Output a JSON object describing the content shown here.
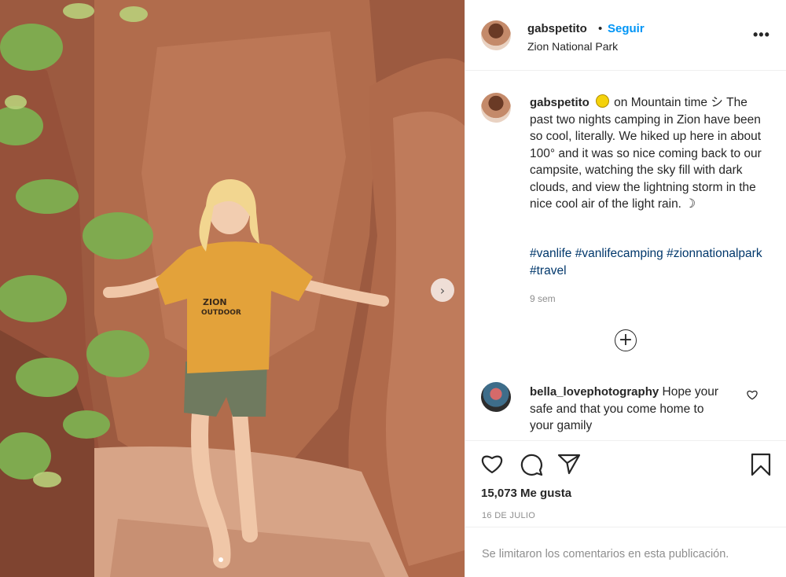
{
  "post": {
    "username": "gabspetito",
    "separator": "•",
    "follow_label": "Seguir",
    "location": "Zion National Park",
    "more_icon": "more-horizontal-icon"
  },
  "caption": {
    "username": "gabspetito",
    "emoji": "lemon-emoji",
    "text": "on Mountain time シ The past two nights camping in Zion have been so cool, literally. We hiked up here in about 100° and it was so nice coming back to our campsite, watching the sky fill with dark clouds, and view the lightning storm in the nice cool air of the light rain. ☽",
    "hashtags": [
      "#vanlife",
      "#vanlifecamping",
      "#zionnationalpark",
      "#travel"
    ],
    "time_ago": "9 sem"
  },
  "comments": [
    {
      "username": "bella_lovephotography",
      "text": "Hope your safe and that you come home to your gamily"
    }
  ],
  "actions": {
    "like_icon": "heart-icon",
    "comment_icon": "comment-icon",
    "share_icon": "paper-plane-icon",
    "save_icon": "bookmark-icon"
  },
  "likes": "15,073 Me gusta",
  "date": "16 DE JULIO",
  "comments_limited": "Se limitaron los comentarios en esta publicación.",
  "photo": {
    "shirt_text": "ZION OUTDOOR",
    "colors": {
      "rock": "#a8603f",
      "shirt": "#e3a23a",
      "shorts": "#6f7a5f",
      "foliage": "#7faa4f"
    }
  }
}
